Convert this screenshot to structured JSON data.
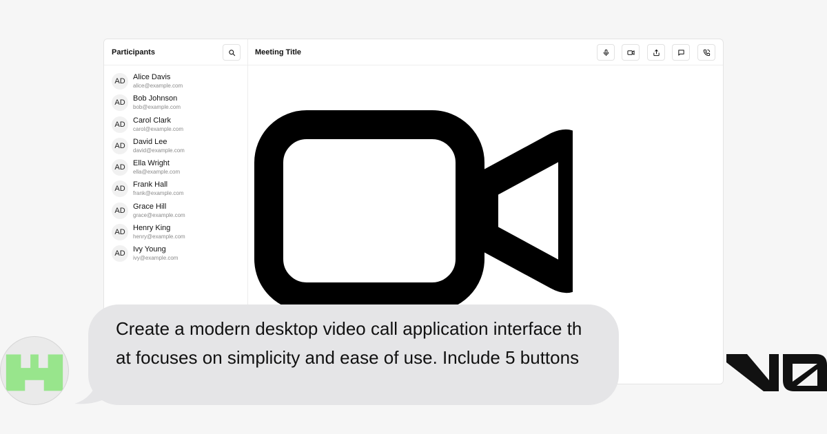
{
  "sidebar": {
    "title": "Participants",
    "search_icon": "search-icon",
    "participants": [
      {
        "initials": "AD",
        "name": "Alice Davis",
        "email": "alice@example.com"
      },
      {
        "initials": "AD",
        "name": "Bob Johnson",
        "email": "bob@example.com"
      },
      {
        "initials": "AD",
        "name": "Carol Clark",
        "email": "carol@example.com"
      },
      {
        "initials": "AD",
        "name": "David Lee",
        "email": "david@example.com"
      },
      {
        "initials": "AD",
        "name": "Ella Wright",
        "email": "ella@example.com"
      },
      {
        "initials": "AD",
        "name": "Frank Hall",
        "email": "frank@example.com"
      },
      {
        "initials": "AD",
        "name": "Grace Hill",
        "email": "grace@example.com"
      },
      {
        "initials": "AD",
        "name": "Henry King",
        "email": "henry@example.com"
      },
      {
        "initials": "AD",
        "name": "Ivy Young",
        "email": "ivy@example.com"
      }
    ]
  },
  "header": {
    "meeting_title": "Meeting Title",
    "controls": [
      "microphone-icon",
      "video-camera-icon",
      "share-icon",
      "chat-icon",
      "phone-icon"
    ]
  },
  "stage": {
    "icon": "video-camera-icon"
  },
  "prompt": {
    "text": "Create a modern desktop video call application interface that focuses on simplicity and ease of use. Include 5 buttons"
  },
  "colors": {
    "bubble": "#e5e5e7",
    "avatar_green": "#98e58c",
    "border": "#e4e4e4"
  }
}
